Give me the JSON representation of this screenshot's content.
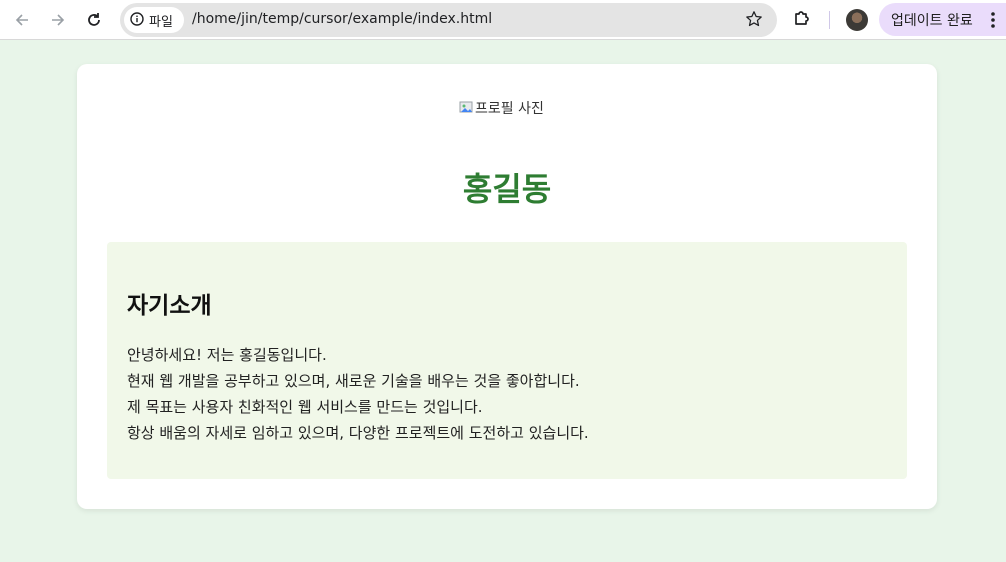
{
  "browser": {
    "site_info_label": "파일",
    "url": "/home/jin/temp/cursor/example/index.html",
    "update_label": "업데이트 완료",
    "icons": {
      "back": "back-arrow-icon",
      "forward": "forward-arrow-icon",
      "reload": "reload-icon",
      "info": "info-icon",
      "bookmark": "star-icon",
      "extensions": "puzzle-icon",
      "menu": "more-vert-icon"
    }
  },
  "page": {
    "profile_image_alt": "프로필 사진",
    "name": "홍길동",
    "intro": {
      "heading": "자기소개",
      "lines": [
        "안녕하세요! 저는 홍길동입니다.",
        "현재 웹 개발을 공부하고 있으며, 새로운 기술을 배우는 것을 좋아합니다.",
        "제 목표는 사용자 친화적인 웹 서비스를 만드는 것입니다.",
        "항상 배움의 자세로 임하고 있으며, 다양한 프로젝트에 도전하고 있습니다."
      ]
    },
    "colors": {
      "background": "#e8f5e9",
      "name_color": "#2e7d32",
      "intro_background": "#f1f8e9"
    }
  }
}
